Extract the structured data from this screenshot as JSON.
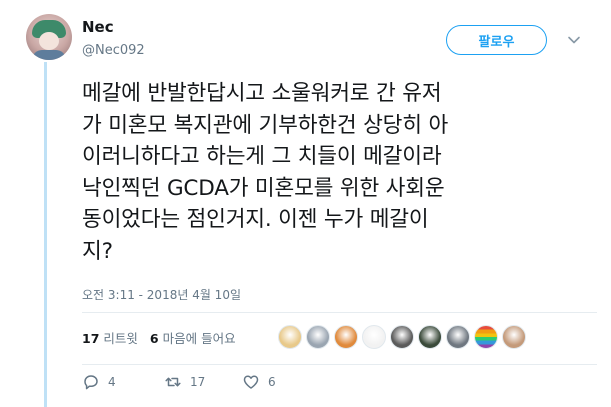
{
  "user": {
    "display_name": "Nec",
    "handle": "@Nec092"
  },
  "follow_button": {
    "label": "팔로우"
  },
  "tweet": {
    "text": "메갈에 반발한답시고 소울워커로 간 유저\n가 미혼모 복지관에 기부하한건 상당히 아\n이러니하다고 하는게 그 치들이 메갈이라\n낙인찍던 GCDA가 미혼모를 위한 사회운\n동이었다는 점인거지. 이젠 누가 메갈이\n지?",
    "timestamp": "오전 3:11 - 2018년 4월 10일"
  },
  "stats": {
    "retweets_count": "17",
    "retweets_label": "리트윗",
    "likes_count": "6",
    "likes_label": "마음에 들어요"
  },
  "liker_avatars": [
    {
      "name": "avatar-1",
      "color": "#e8c98a"
    },
    {
      "name": "avatar-2",
      "color": "#9aa5b1"
    },
    {
      "name": "avatar-3",
      "color": "#e08a3c"
    },
    {
      "name": "avatar-4",
      "color": "#f2f2f2"
    },
    {
      "name": "avatar-5",
      "color": "#5b5b5b"
    },
    {
      "name": "avatar-6",
      "color": "#3a4a3a"
    },
    {
      "name": "avatar-7",
      "color": "#6f7780"
    },
    {
      "name": "avatar-8",
      "color": "rainbow"
    },
    {
      "name": "avatar-9",
      "color": "#c49a7a"
    }
  ],
  "actions": {
    "reply_count": "4",
    "retweet_count": "17",
    "like_count": "6"
  },
  "colors": {
    "accent": "#1da1f2",
    "secondary_text": "#657786",
    "divider": "#e6ecf0"
  },
  "icons": [
    "chevron-down-icon",
    "reply-icon",
    "retweet-icon",
    "like-icon"
  ]
}
